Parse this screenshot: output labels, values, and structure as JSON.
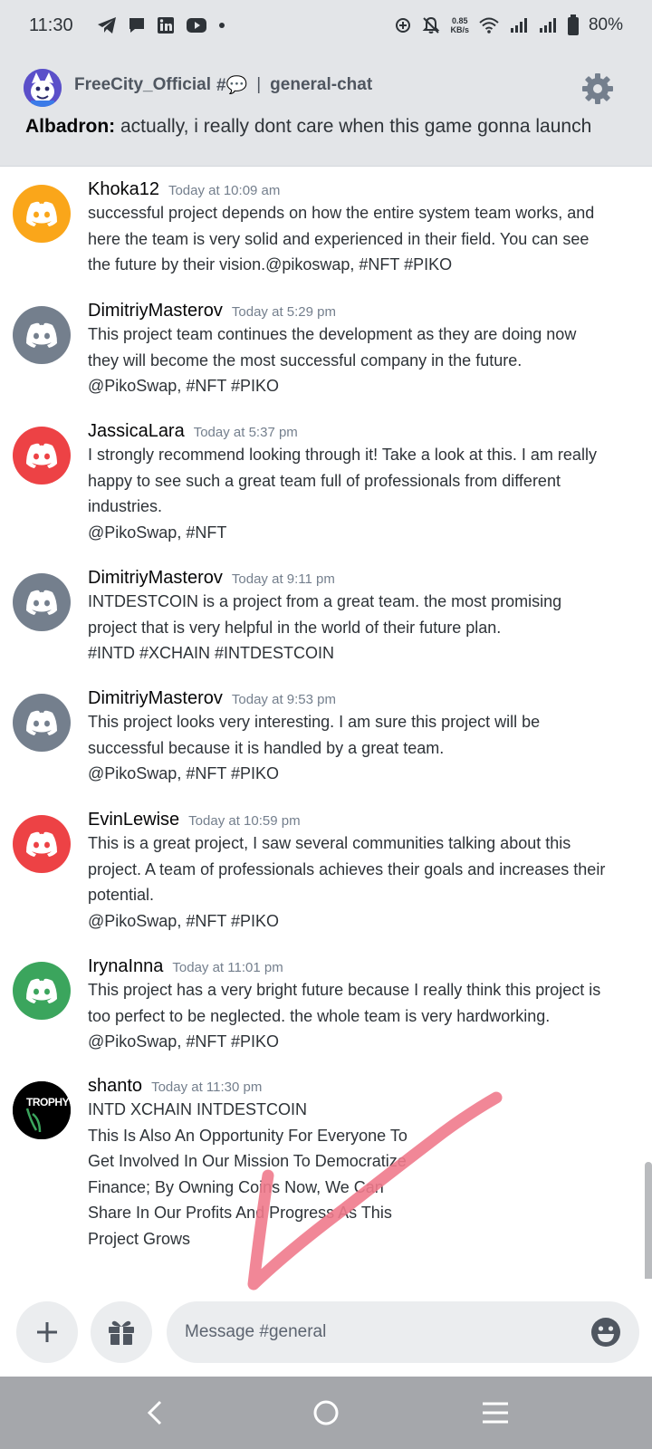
{
  "status_bar": {
    "time": "11:30",
    "net_speed_value": "0.85",
    "net_speed_unit": "KB/s",
    "battery": "80%"
  },
  "header": {
    "server_name": "FreeCity_Official",
    "channel_hash": "#💬",
    "channel_name": "general-chat",
    "pinned_author": "Albadron:",
    "pinned_text": " actually, i really dont care when this game gonna launch"
  },
  "messages": [
    {
      "author": "Khoka12",
      "time": "Today at 10:09 am",
      "avatar_color": "#faa61a",
      "lines": [
        "successful project depends on how the entire system team works, and",
        "here the team is very solid and experienced in their field. You can see",
        "the future by their vision.@pikoswap, #NFT #PIKO"
      ]
    },
    {
      "author": "DimitriyMasterov",
      "time": "Today at 5:29 pm",
      "avatar_color": "#747f8d",
      "lines": [
        "This project team continues the development as they are doing now",
        "they will become the most successful company in the future.",
        "@PikoSwap, #NFT #PIKO"
      ]
    },
    {
      "author": "JassicaLara",
      "time": "Today at 5:37 pm",
      "avatar_color": "#ed4245",
      "lines": [
        "I strongly recommend looking through it!  Take a look at this. I am really",
        "happy to see such a great team full of professionals from different",
        "industries.",
        "@PikoSwap, #NFT"
      ]
    },
    {
      "author": "DimitriyMasterov",
      "time": "Today at 9:11 pm",
      "avatar_color": "#747f8d",
      "lines": [
        "INTDESTCOIN is a project from a great team. the most promising",
        "project that is very helpful in the world of their future plan.",
        "#INTD #XCHAIN  #INTDESTCOIN"
      ]
    },
    {
      "author": "DimitriyMasterov",
      "time": "Today at 9:53 pm",
      "avatar_color": "#747f8d",
      "lines": [
        "This project looks very interesting. I am sure this project will be",
        "successful because it is handled by a great team.",
        "@PikoSwap, #NFT #PIKO"
      ]
    },
    {
      "author": "EvinLewise",
      "time": "Today at 10:59 pm",
      "avatar_color": "#ed4245",
      "lines": [
        "This is a great project, I saw several communities talking about this",
        "project. A team of professionals achieves their goals and increases their",
        "potential.",
        "@PikoSwap, #NFT #PIKO"
      ]
    },
    {
      "author": "IrynaInna",
      "time": "Today at 11:01 pm",
      "avatar_color": "#3ba55d",
      "lines": [
        "This project has a very bright future because I really think this project is",
        "too perfect to be neglected. the whole team is very hardworking.",
        "@PikoSwap, #NFT #PIKO"
      ]
    },
    {
      "author": "shanto",
      "time": "Today at 11:30 pm",
      "avatar_text": "TROPHY",
      "lines": [
        "INTD  XCHAIN  INTDESTCOIN",
        "This Is Also An Opportunity For Everyone To",
        "Get Involved In Our Mission To Democratize",
        "Finance; By Owning Coins Now, We Can",
        "Share In Our Profits And Progress As This",
        "Project Grows"
      ]
    }
  ],
  "input": {
    "placeholder": "Message #general"
  },
  "colors": {
    "header_bg": "#e3e5e8",
    "annotation_stroke": "#f07a8c"
  }
}
